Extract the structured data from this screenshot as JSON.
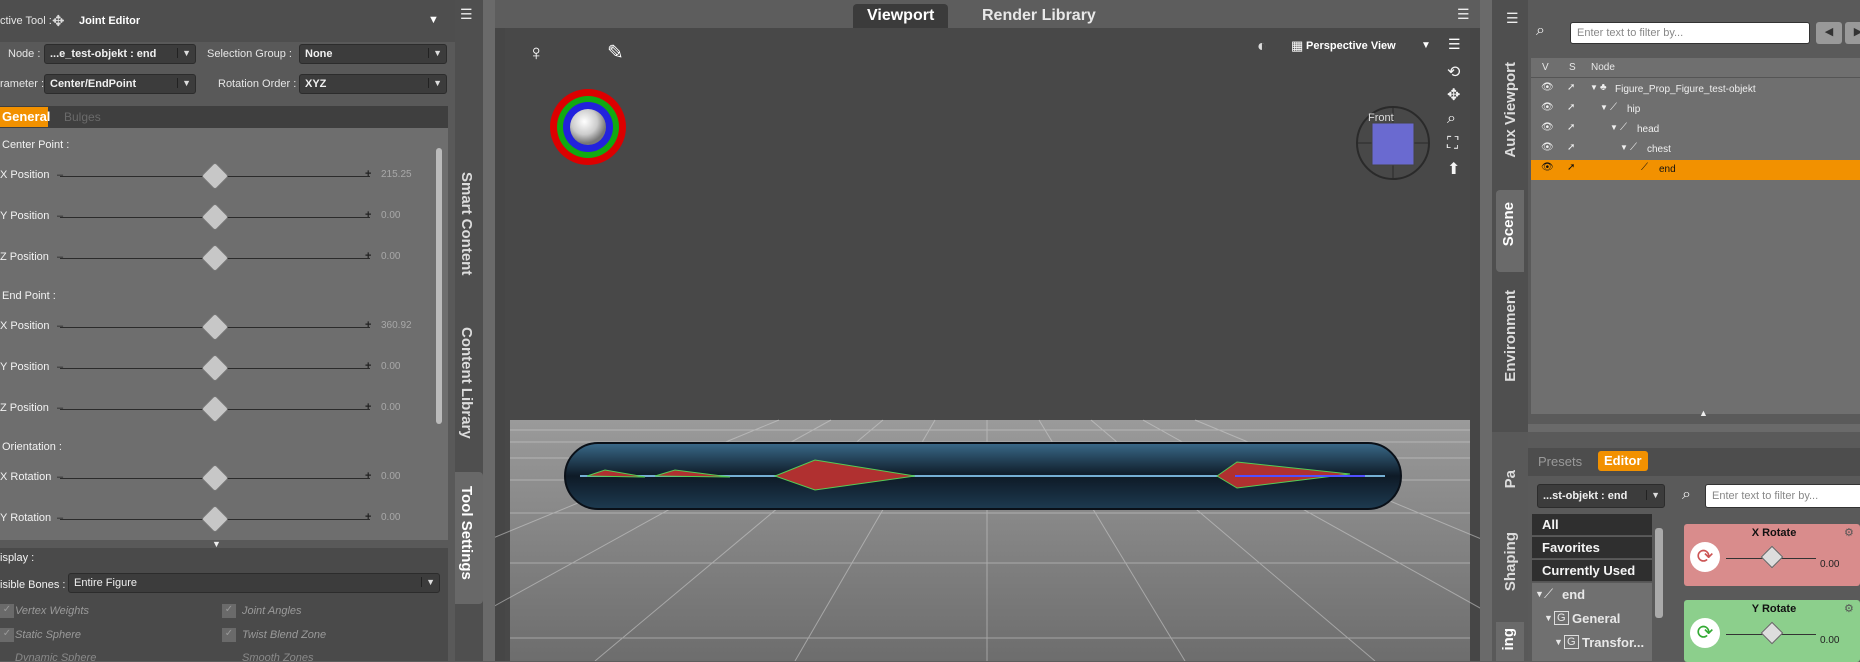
{
  "tool_settings": {
    "active_tool_label": "ctive Tool :",
    "active_tool": "Joint Editor",
    "node_label": "Node :",
    "node_value": "...e_test-objekt : end",
    "selection_group_label": "Selection Group :",
    "selection_group_value": "None",
    "parameter_label": "rameter :",
    "parameter_value": "Center/EndPoint",
    "rotation_order_label": "Rotation Order :",
    "rotation_order_value": "XYZ",
    "tabs": [
      "General",
      "Bulges"
    ],
    "center_point_label": "Center Point :",
    "end_point_label": "End Point :",
    "orientation_label": "Orientation :",
    "sliders": [
      {
        "name": "X Position",
        "value": "215.25"
      },
      {
        "name": "Y Position",
        "value": "0.00"
      },
      {
        "name": "Z Position",
        "value": "0.00"
      },
      {
        "name": "X Position",
        "value": "360.92"
      },
      {
        "name": "Y Position",
        "value": "0.00"
      },
      {
        "name": "Z Position",
        "value": "0.00"
      },
      {
        "name": "X Rotation",
        "value": "0.00"
      },
      {
        "name": "Y Rotation",
        "value": "0.00"
      }
    ],
    "display_label": "isplay :",
    "visible_bones_label": "isible Bones :",
    "visible_bones_value": "Entire Figure",
    "checkboxes": [
      "Vertex Weights",
      "Joint Angles",
      "Static Sphere",
      "Twist Blend Zone",
      "Dynamic Sphere",
      "Smooth Zones"
    ]
  },
  "side_tabs_left": [
    "Smart Content",
    "Content Library",
    "Tool Settings"
  ],
  "viewport": {
    "tabs": [
      "Viewport",
      "Render Library"
    ],
    "view_mode": "Perspective View",
    "cube_face": "Front"
  },
  "side_tabs_right": [
    "Aux Viewport",
    "Scene",
    "Environment"
  ],
  "scene": {
    "filter_placeholder": "Enter text to filter by...",
    "columns": [
      "V",
      "S",
      "Node"
    ],
    "nodes": [
      {
        "name": "Figure_Prop_Figure_test-objekt",
        "depth": 0,
        "selected": false
      },
      {
        "name": "hip",
        "depth": 1,
        "selected": false
      },
      {
        "name": "head",
        "depth": 2,
        "selected": false
      },
      {
        "name": "chest",
        "depth": 3,
        "selected": false
      },
      {
        "name": "end",
        "depth": 4,
        "selected": true
      }
    ]
  },
  "params": {
    "tabs": [
      "Presets",
      "Editor"
    ],
    "node": "...st-objekt : end",
    "filter_placeholder": "Enter text to filter by...",
    "categories": [
      "All",
      "Favorites",
      "Currently Used"
    ],
    "tree": [
      "end",
      "General",
      "Transfor..."
    ],
    "side_tabs": [
      "Pa",
      "Shaping",
      "ing"
    ],
    "cards": [
      {
        "name": "X Rotate",
        "value": "0.00",
        "color": "#d98c8c"
      },
      {
        "name": "Y Rotate",
        "value": "0.00",
        "color": "#8ccf8c"
      }
    ]
  },
  "colors": {
    "accent": "#f29100",
    "selected_row": "#f29100"
  }
}
